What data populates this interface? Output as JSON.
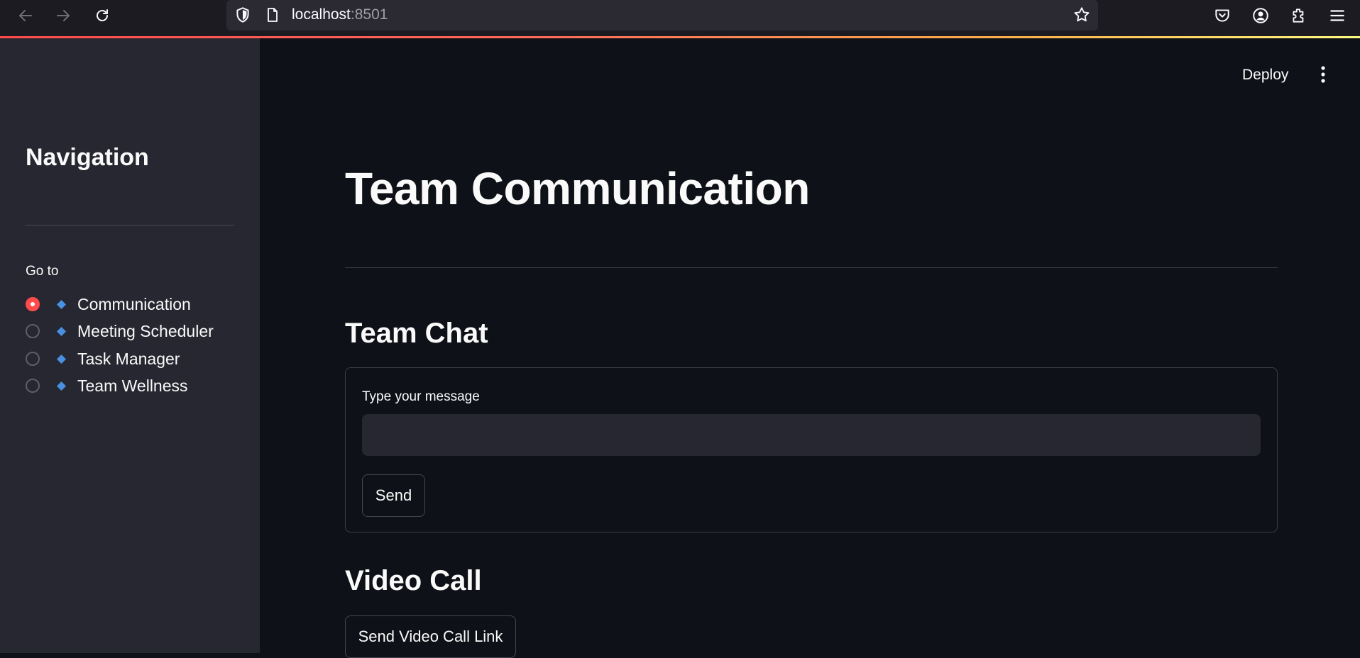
{
  "browser": {
    "url_host": "localhost",
    "url_port": ":8501",
    "icons": [
      "back-arrow-icon",
      "forward-arrow-icon",
      "reload-icon",
      "shield-icon",
      "page-icon",
      "star-icon",
      "pocket-icon",
      "account-icon",
      "extensions-icon",
      "hamburger-menu-icon"
    ]
  },
  "sidebar": {
    "title": "Navigation",
    "radio_label": "Go to",
    "items": [
      {
        "label": "Communication",
        "checked": true
      },
      {
        "label": "Meeting Scheduler",
        "checked": false
      },
      {
        "label": "Task Manager",
        "checked": false
      },
      {
        "label": "Team Wellness",
        "checked": false
      }
    ]
  },
  "header": {
    "deploy_label": "Deploy"
  },
  "main": {
    "title": "Team Communication",
    "chat": {
      "heading": "Team Chat",
      "input_label": "Type your message",
      "input_value": "",
      "send_label": "Send"
    },
    "video": {
      "heading": "Video Call",
      "button_label": "Send Video Call Link"
    }
  },
  "colors": {
    "background": "#0e1117",
    "sidebar": "#262730",
    "accent": "#ff4b4b",
    "diamond": "#4a90e2",
    "text": "#fafafa"
  }
}
